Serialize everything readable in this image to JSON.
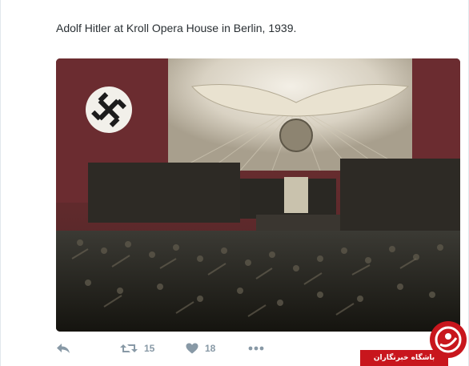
{
  "tweet": {
    "text": "Adolf Hitler at Kroll Opera House in Berlin, 1939."
  },
  "actions": {
    "reply": {
      "icon": "reply-icon"
    },
    "retweet": {
      "icon": "retweet-icon",
      "count": "15"
    },
    "like": {
      "icon": "heart-icon",
      "count": "18"
    },
    "more": {
      "icon": "more-icon"
    }
  },
  "watermark": {
    "text": "باشگاه خبرنگاران",
    "brand_color": "#c8161d"
  },
  "colors": {
    "text": "#292f33",
    "icon_gray": "#8899a6",
    "border": "#e1e8ed"
  }
}
